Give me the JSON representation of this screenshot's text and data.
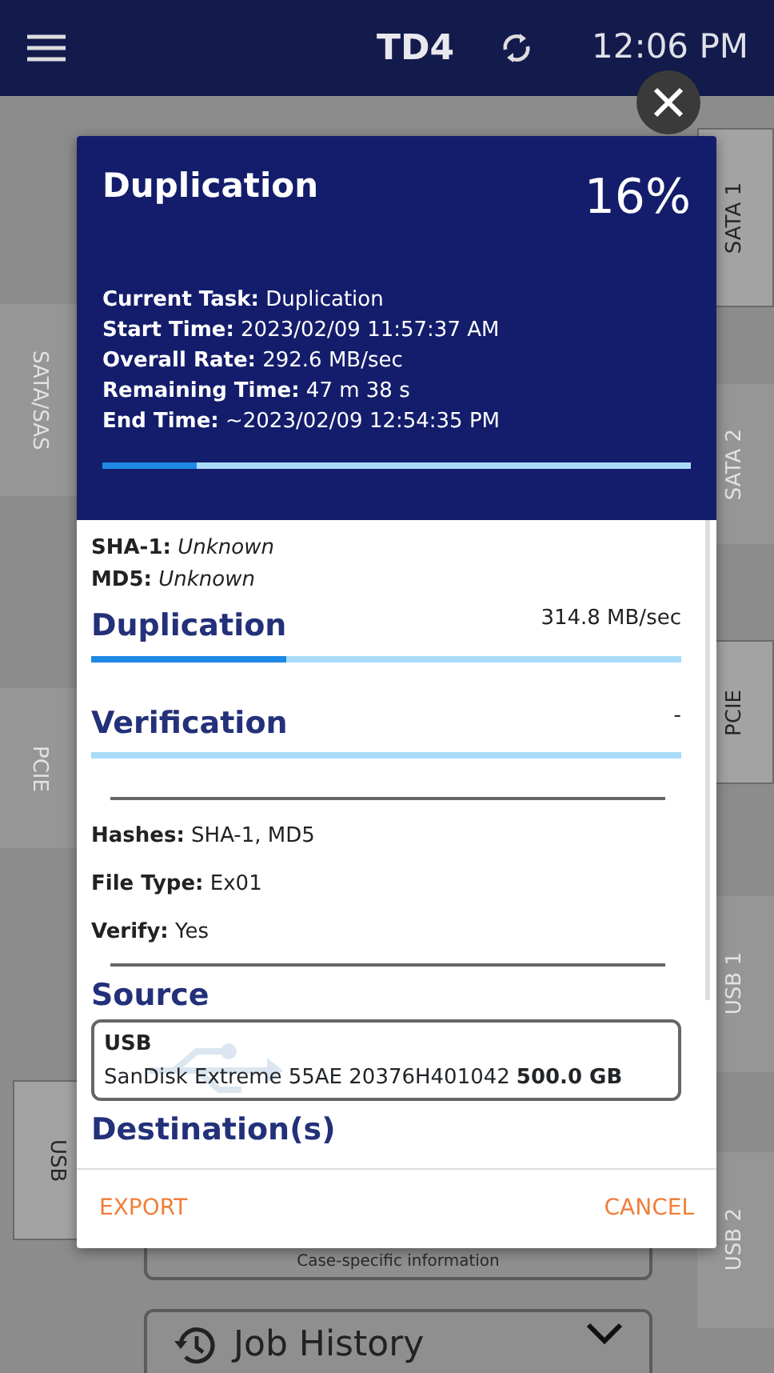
{
  "status_bar": {
    "title": "TD4",
    "time": "12:06 PM"
  },
  "left_tabs": [
    {
      "label": "SATA/SAS",
      "connected": false
    },
    {
      "label": "PCIE",
      "connected": false
    },
    {
      "label": "USB",
      "connected": true
    }
  ],
  "right_tabs": [
    {
      "label": "SATA 1",
      "connected": true
    },
    {
      "label": "SATA 2",
      "connected": false
    },
    {
      "label": "PCIE",
      "connected": true
    },
    {
      "label": "USB 1",
      "connected": false
    },
    {
      "label": "USB 2",
      "connected": false
    }
  ],
  "background": {
    "info_text": "Case-specific information",
    "job_history": "Job History"
  },
  "dialog": {
    "title": "Duplication",
    "percent": "16%",
    "details": [
      "**Current Task:** Duplication",
      "**Start Time:** 2023/02/09 11:57:37 AM",
      "**Overall Rate:** 292.6 MB/sec",
      "**Remaining Time:** 47 m 38 s",
      "**End Time:** ~2023/02/09 12:54:35 PM"
    ],
    "level": 0.16,
    "hashes": [
      "**SHA-1:** *Unknown*",
      "**MD5:** *Unknown*"
    ],
    "stages": [
      {
        "name": "Duplication",
        "reading": "314.8 MB/sec",
        "level": 0.33
      },
      {
        "name": "Verification",
        "reading": "-",
        "level": 0
      }
    ],
    "settings": [
      "**Hashes:** SHA-1, MD5",
      "**File Type:** Ex01",
      "**Verify:** Yes"
    ],
    "source": {
      "heading": "Source",
      "type": "USB",
      "device": "SanDisk Extreme 55AE 20376H401042",
      "size": "500.0 GB"
    },
    "destination_heading": "Destination(s)",
    "buttons": [
      {
        "label": "EXPORT"
      },
      {
        "label": "CANCEL"
      }
    ]
  }
}
